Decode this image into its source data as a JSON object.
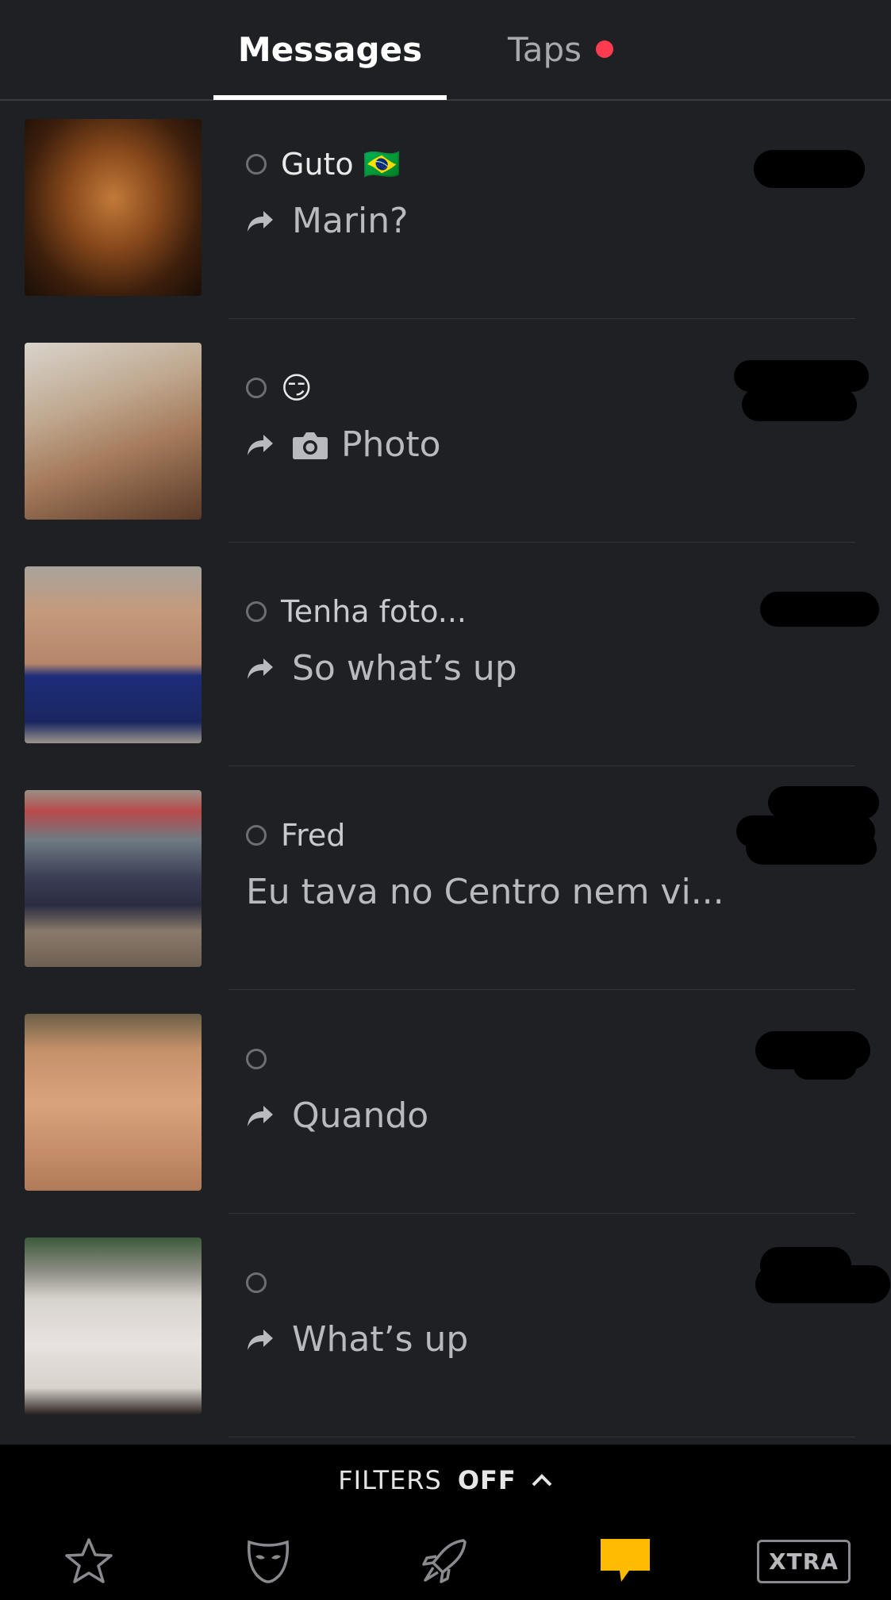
{
  "tabs": {
    "messages": "Messages",
    "taps": "Taps"
  },
  "conversations": [
    {
      "name": "Guto 🇧🇷",
      "message": "Marin?",
      "replied": true
    },
    {
      "name": "😏",
      "message": "Photo",
      "replied": true,
      "photo": true
    },
    {
      "name": "Tenha foto...",
      "message": "So what’s up",
      "replied": true
    },
    {
      "name": "Fred",
      "message": "Eu tava no Centro nem vi...",
      "replied": false
    },
    {
      "name": "",
      "message": "Quando",
      "replied": true
    },
    {
      "name": "",
      "message": "What’s up",
      "replied": true
    }
  ],
  "filters": {
    "label": "FILTERS",
    "value": "OFF"
  },
  "nav": {
    "xtra": "XTRA"
  },
  "colors": {
    "accent": "#ffbb00",
    "badge": "#ff3b50",
    "background": "#1f2023"
  }
}
